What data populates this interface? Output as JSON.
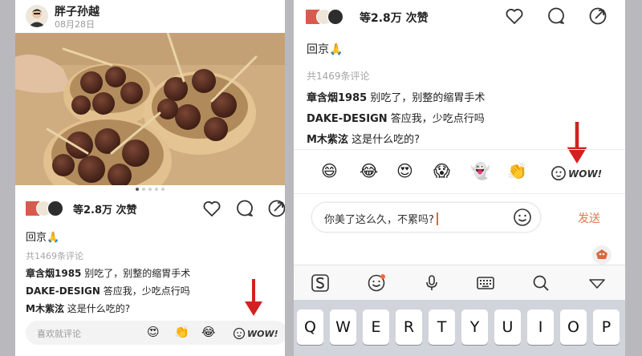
{
  "left": {
    "author": "胖子孙越",
    "date": "08月28日",
    "image_alt": "几碗炸丸子",
    "like_text": "等2.8万 次赞",
    "caption": "回京🙏",
    "comment_count": "共1469条评论",
    "comments": [
      {
        "user": "章含烟1985",
        "text": "别吃了，别整的缩胃手术"
      },
      {
        "user": "DAKE-DESIGN",
        "text": "答应我，少吃点行吗"
      },
      {
        "user": "M木紫泫",
        "text": "这是什么吃的?"
      }
    ],
    "input_placeholder": "喜欢就评论",
    "quick_emojis": [
      "😍",
      "👏",
      "😂"
    ],
    "wow_label": "WOW!"
  },
  "right": {
    "like_text": "等2.8万 次赞",
    "caption": "回京🙏",
    "comment_count": "共1469条评论",
    "comments": [
      {
        "user": "章含烟1985",
        "text": "别吃了，别整的缩胃手术"
      },
      {
        "user": "DAKE-DESIGN",
        "text": "答应我，少吃点行吗"
      },
      {
        "user": "M木紫泫",
        "text": "这是什么吃的?"
      }
    ],
    "emoji_bar": [
      "😄",
      "😂",
      "😍",
      "😱",
      "👻",
      "👏"
    ],
    "wow_label": "WOW!",
    "compose_value": "你美了这么久，不累吗?",
    "send_label": "发送",
    "keyboard_row": [
      "Q",
      "W",
      "E",
      "R",
      "T",
      "Y",
      "U",
      "I",
      "O",
      "P"
    ],
    "toolbar_icons": [
      "sogou-s-icon",
      "emoji-icon",
      "microphone-icon",
      "keyboard-icon",
      "search-icon",
      "collapse-icon"
    ]
  },
  "colors": {
    "arrow_red": "#d42020",
    "send_orange": "#e07a48",
    "caret_orange": "#e06a2e",
    "notify_dot": "#f2683a"
  }
}
